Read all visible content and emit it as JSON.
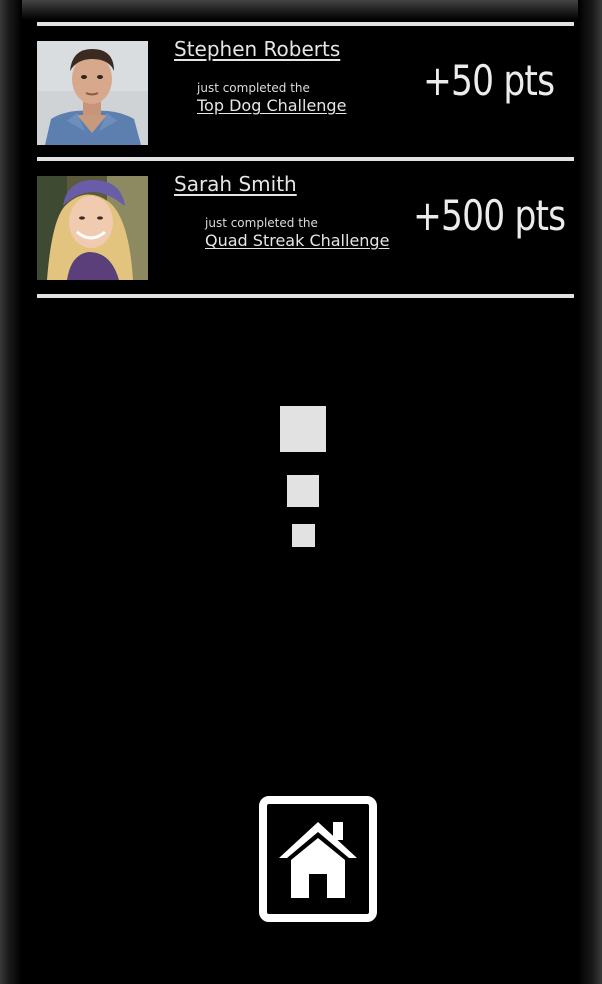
{
  "feed": [
    {
      "user_name": "Stephen Roberts",
      "activity_text": "just completed the",
      "challenge_name": "Top Dog Challenge",
      "points": "+50 pts",
      "avatar_icon": "male-user-photo"
    },
    {
      "user_name": "Sarah Smith",
      "activity_text": "just completed the",
      "challenge_name": "Quad Streak Challenge",
      "points": "+500 pts",
      "avatar_icon": "female-user-photo"
    }
  ],
  "loader": {
    "icon": "loading-blocks-icon"
  },
  "home": {
    "icon": "home-icon"
  },
  "colors": {
    "background": "#000000",
    "divider": "#e2e2e2",
    "text": "#e6e6e6"
  }
}
